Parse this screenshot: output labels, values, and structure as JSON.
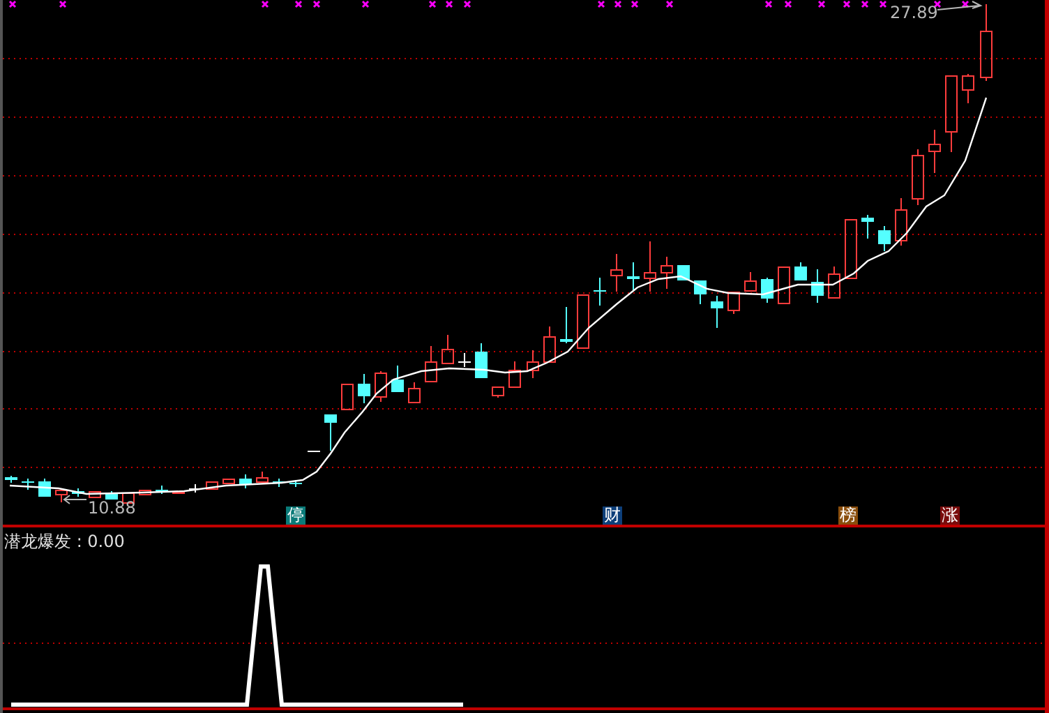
{
  "price_chart": {
    "high_label": "27.89",
    "low_label": "10.88",
    "markers": [
      {
        "label": "停",
        "color": "#0a7a78"
      },
      {
        "label": "财",
        "color": "#0d3f7a"
      },
      {
        "label": "榜",
        "color": "#8a4e0c"
      },
      {
        "label": "涨",
        "color": "#7a0c0c"
      }
    ]
  },
  "indicator_pane": {
    "title": "潜龙爆发 : 0.00"
  }
}
